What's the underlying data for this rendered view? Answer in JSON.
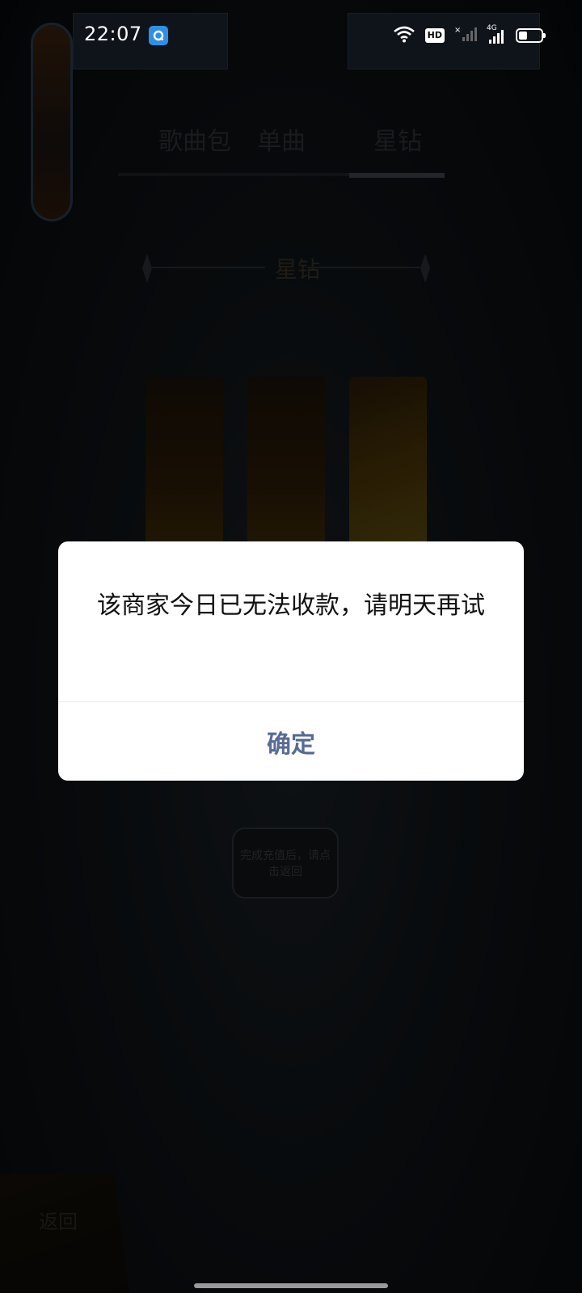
{
  "status_bar": {
    "time": "22:07",
    "network_badge": "HD",
    "cell_label": "4G",
    "icons": [
      "app-q-icon",
      "wifi-icon",
      "hd-icon",
      "no-signal-icon",
      "signal-icon",
      "battery-icon"
    ]
  },
  "game_bg": {
    "tabs": [
      {
        "label": "歌曲包"
      },
      {
        "label": "单曲"
      },
      {
        "label": "星钻"
      }
    ],
    "active_tab": 2,
    "section_title": "星钻",
    "hint_button": "完成充值后，请点击返回",
    "back_button": "返回"
  },
  "dialog": {
    "message": "该商家今日已无法收款，请明天再试",
    "confirm_label": "确定",
    "accent_color": "#576b95"
  }
}
